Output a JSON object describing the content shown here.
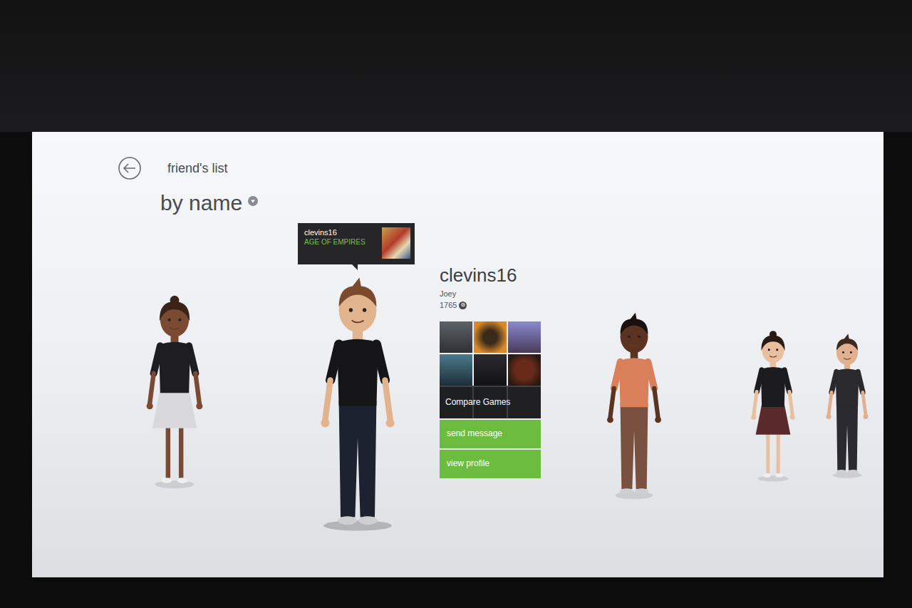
{
  "header": {
    "title": "friend's list",
    "sort": "by name"
  },
  "friends": [
    {
      "kind": "female",
      "color": "#1e1e22",
      "selected": false
    },
    {
      "kind": "male",
      "color": "#151517",
      "selected": true
    },
    {
      "kind": "male",
      "color": "#d9805a",
      "selected": false
    },
    {
      "kind": "female",
      "color": "#1c1c20",
      "selected": false
    },
    {
      "kind": "male",
      "color": "#2a2a2e",
      "selected": false
    }
  ],
  "tooltip": {
    "gamertag": "clevins16",
    "game": "AGE OF EMPIRES"
  },
  "profile": {
    "gamertag": "clevins16",
    "real_name": "Joey",
    "gamerscore": "1765",
    "gamerscore_icon": "G",
    "compare": "Compare Games",
    "actions": [
      {
        "label": "send message"
      },
      {
        "label": "view profile"
      }
    ]
  }
}
